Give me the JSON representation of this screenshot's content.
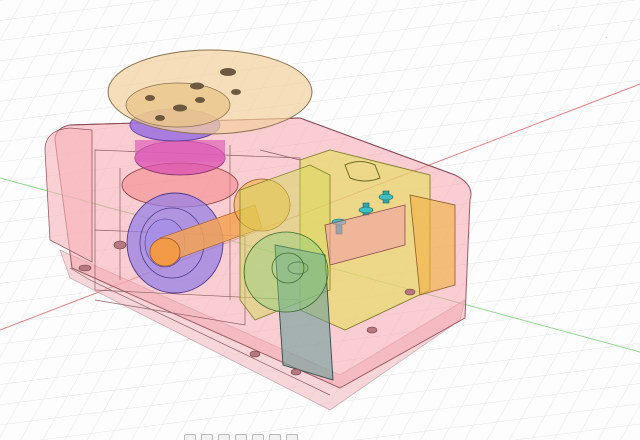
{
  "viewport": {
    "background": "#fdfdfd",
    "grid_color": "#dddddd",
    "x_axis_color": "#e06a6a",
    "y_axis_color": "#6ccb6c"
  },
  "model": {
    "components": [
      {
        "name": "output-horn",
        "color": "#f0d3a0"
      },
      {
        "name": "housing",
        "color": "#f4a9b0"
      },
      {
        "name": "output-gear",
        "color": "#d855b0"
      },
      {
        "name": "motor",
        "color": "#9f86e6"
      },
      {
        "name": "motor-shaft",
        "color": "#f3a65a"
      },
      {
        "name": "control-board",
        "color": "#dede55"
      },
      {
        "name": "connector-pins",
        "color": "#2fa8a8"
      },
      {
        "name": "side-plate",
        "color": "#6aa7a0"
      }
    ]
  },
  "navigation_bar": {
    "tools": [
      "orbit-icon",
      "look-at-icon",
      "pan-icon",
      "zoom-icon",
      "fit-icon",
      "display-settings-icon",
      "grid-settings-icon"
    ]
  }
}
